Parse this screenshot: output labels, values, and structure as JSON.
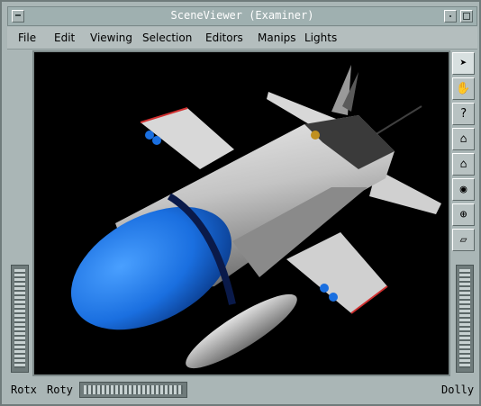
{
  "window": {
    "title": "SceneViewer (Examiner)"
  },
  "menu": [
    "File",
    "Edit",
    "Viewing",
    "Selection",
    "Editors",
    "Manips",
    "Lights"
  ],
  "viewer_tools": [
    {
      "name": "pick-arrow-icon",
      "glyph": "➤"
    },
    {
      "name": "view-hand-icon",
      "glyph": "✋"
    },
    {
      "name": "help-icon",
      "glyph": "?"
    },
    {
      "name": "home-icon",
      "glyph": "⌂"
    },
    {
      "name": "set-home-icon",
      "glyph": "⌂"
    },
    {
      "name": "view-all-icon",
      "glyph": "◉"
    },
    {
      "name": "seek-icon",
      "glyph": "⊕"
    },
    {
      "name": "perspective-icon",
      "glyph": "▱"
    }
  ],
  "wheels": {
    "rotx_label": "Rotx",
    "roty_label": "Roty",
    "dolly_label": "Dolly"
  },
  "colors": {
    "background": "#000000",
    "nose": "#1a6fe0",
    "fuselage": "#c8c8c8"
  }
}
